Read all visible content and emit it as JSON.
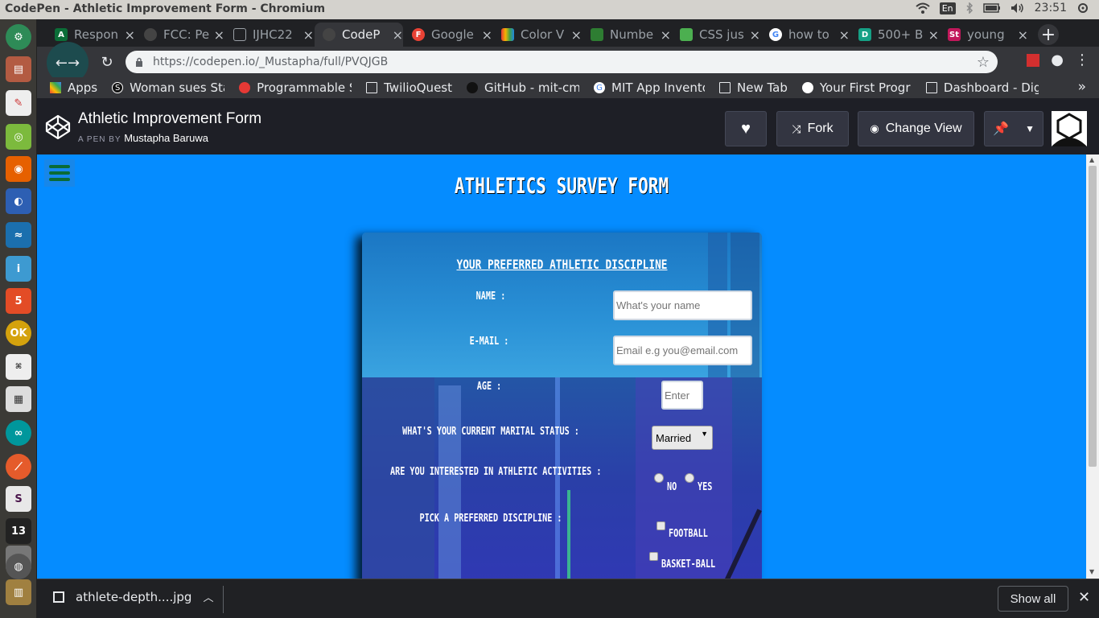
{
  "os": {
    "window_title": "CodePen - Athletic Improvement Form - Chromium",
    "keyboard": "En",
    "clock": "23:51"
  },
  "launcher": [
    "ubuntu-settings",
    "files",
    "libreoffice",
    "spotify",
    "firefox",
    "blue-app",
    "browser-wave",
    "web-app",
    "html5-app",
    "ok-badge",
    "keys-app",
    "grid-app",
    "arduino",
    "red-app",
    "slack",
    "chromium-13",
    "drive",
    "chromium",
    "archive"
  ],
  "tabs": [
    {
      "label": "Respon",
      "fav": "A",
      "fav_color": "#0b6e38"
    },
    {
      "label": "FCC: Pe",
      "fav": "",
      "fav_color": "#444"
    },
    {
      "label": "IJHC22",
      "fav": "",
      "fav_color": "#444"
    },
    {
      "label": "CodeP",
      "fav": "",
      "fav_color": "#444"
    },
    {
      "label": "Google",
      "fav": "F",
      "fav_color": "#e94235"
    },
    {
      "label": "Color V",
      "fav": "",
      "fav_color": "#f4b400"
    },
    {
      "label": "Numbe",
      "fav": "",
      "fav_color": "#2e7d32"
    },
    {
      "label": "CSS jus",
      "fav": "",
      "fav_color": "#4caf50"
    },
    {
      "label": "how to",
      "fav": "G",
      "fav_color": "#4285f4"
    },
    {
      "label": "500+ B",
      "fav": "D",
      "fav_color": "#16a085"
    },
    {
      "label": "young",
      "fav": "St",
      "fav_color": "#c2185b"
    }
  ],
  "toolbar": {
    "url": "https://codepen.io/_Mustapha/full/PVQJGB"
  },
  "bookmarks": [
    {
      "label": "Apps",
      "icon_color": "#ea4335"
    },
    {
      "label": "Woman sues Sta",
      "icon_color": "#111"
    },
    {
      "label": "Programmable S",
      "icon_color": "#e53935"
    },
    {
      "label": "TwilioQuest",
      "icon_color": "#fff"
    },
    {
      "label": "GitHub - mit-cml",
      "icon_color": "#111"
    },
    {
      "label": "MIT App Invento",
      "icon_color": "#4285f4"
    },
    {
      "label": "New Tab",
      "icon_color": "#fff"
    },
    {
      "label": "Your First Progr",
      "icon_color": "#fff"
    },
    {
      "label": "Dashboard - Digi",
      "icon_color": "#fff"
    }
  ],
  "codepen": {
    "title": "Athletic Improvement Form",
    "by_prefix": "A PEN BY",
    "author": "Mustapha Baruwa",
    "fork_label": "Fork",
    "change_view_label": "Change View"
  },
  "page": {
    "heading": "ATHLETICS SURVEY FORM",
    "form_title": "YOUR PREFERRED ATHLETIC DISCIPLINE",
    "name_label": "NAME :",
    "name_placeholder": "What's your name",
    "email_label": "E-MAIL :",
    "email_placeholder": "Email e.g you@email.com",
    "age_label": "AGE :",
    "age_placeholder": "Enter",
    "marital_label": "WHAT'S YOUR CURRENT MARITAL STATUS :",
    "marital_value": "Married",
    "interested_label": "ARE YOU INTERESTED IN ATHLETIC ACTIVITIES :",
    "radio_no": "NO",
    "radio_yes": "YES",
    "discipline_label": "PICK A PREFERRED DISCIPLINE :",
    "check_football": "FOOTBALL",
    "check_basketball": "BASKET-BALL"
  },
  "downloads": {
    "file": "athlete-depth....jpg",
    "show_all": "Show all"
  }
}
